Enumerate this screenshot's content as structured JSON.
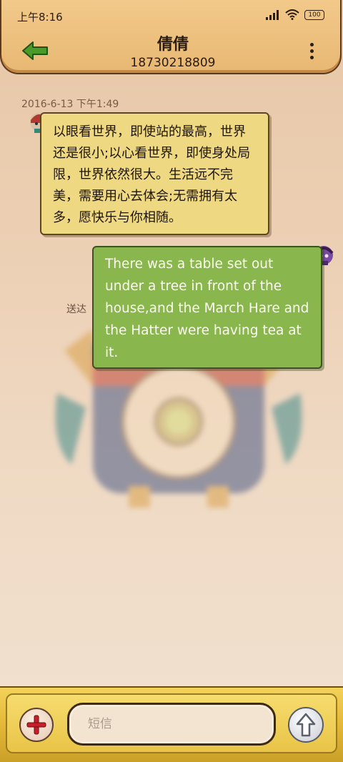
{
  "status_bar": {
    "time": "上午8:16",
    "battery": "100"
  },
  "header": {
    "contact_name": "倩倩",
    "phone_number": "18730218809"
  },
  "conversation": {
    "timestamp": "2016-6-13 下午1:49",
    "messages": [
      {
        "direction": "incoming",
        "text": "以眼看世界，即使站的最高，世界还是很小;以心看世界，即使身处局限，世界依然很大。生活远不完美，需要用心去体会;无需拥有太多，愿快乐与你相随。"
      },
      {
        "direction": "outgoing",
        "text": "There was a table set out under a tree in front of the house,and the March Hare and the Hatter were having tea at it.",
        "status": "送达"
      }
    ]
  },
  "composer": {
    "placeholder": "短信"
  },
  "icons": {
    "back": "arrow-left-icon",
    "menu": "more-vertical-icon",
    "add": "plus-icon",
    "send": "arrow-up-icon"
  },
  "colors": {
    "header_bg": "#eabe7c",
    "incoming_bubble": "#efd882",
    "outgoing_bubble": "#8ab64e",
    "bottom_bar": "#e5b836",
    "back_arrow": "#4a9a2a",
    "add_plus": "#c8202a"
  }
}
